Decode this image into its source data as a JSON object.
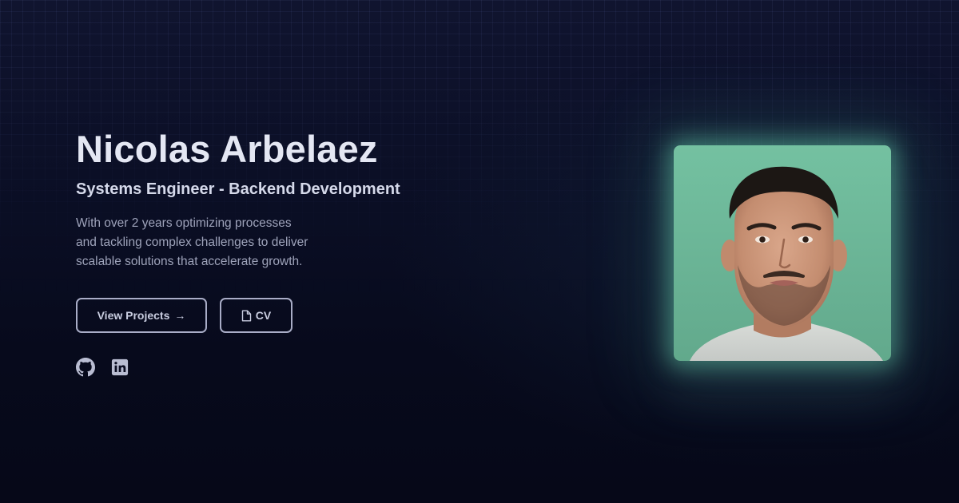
{
  "hero": {
    "name": "Nicolas Arbelaez",
    "role": "Systems Engineer - Backend Development",
    "bio_lines": [
      "With over 2 years optimizing processes",
      "and tackling complex challenges to deliver",
      "scalable solutions that accelerate growth."
    ]
  },
  "buttons": {
    "projects_label": "View Projects",
    "projects_arrow": "→",
    "cv_label": "CV",
    "cv_icon": "file-icon"
  },
  "socials": [
    {
      "icon": "github-icon"
    },
    {
      "icon": "linkedin-icon"
    }
  ],
  "photo": {
    "icon": "profile-photo",
    "background_color": "#6dbb9b"
  },
  "colors": {
    "background": "#070a1c",
    "heading": "#e4e7f3",
    "body_text": "#9ea3ba",
    "button_border": "#a9adc7",
    "photo_glow": "#5fbea0"
  }
}
